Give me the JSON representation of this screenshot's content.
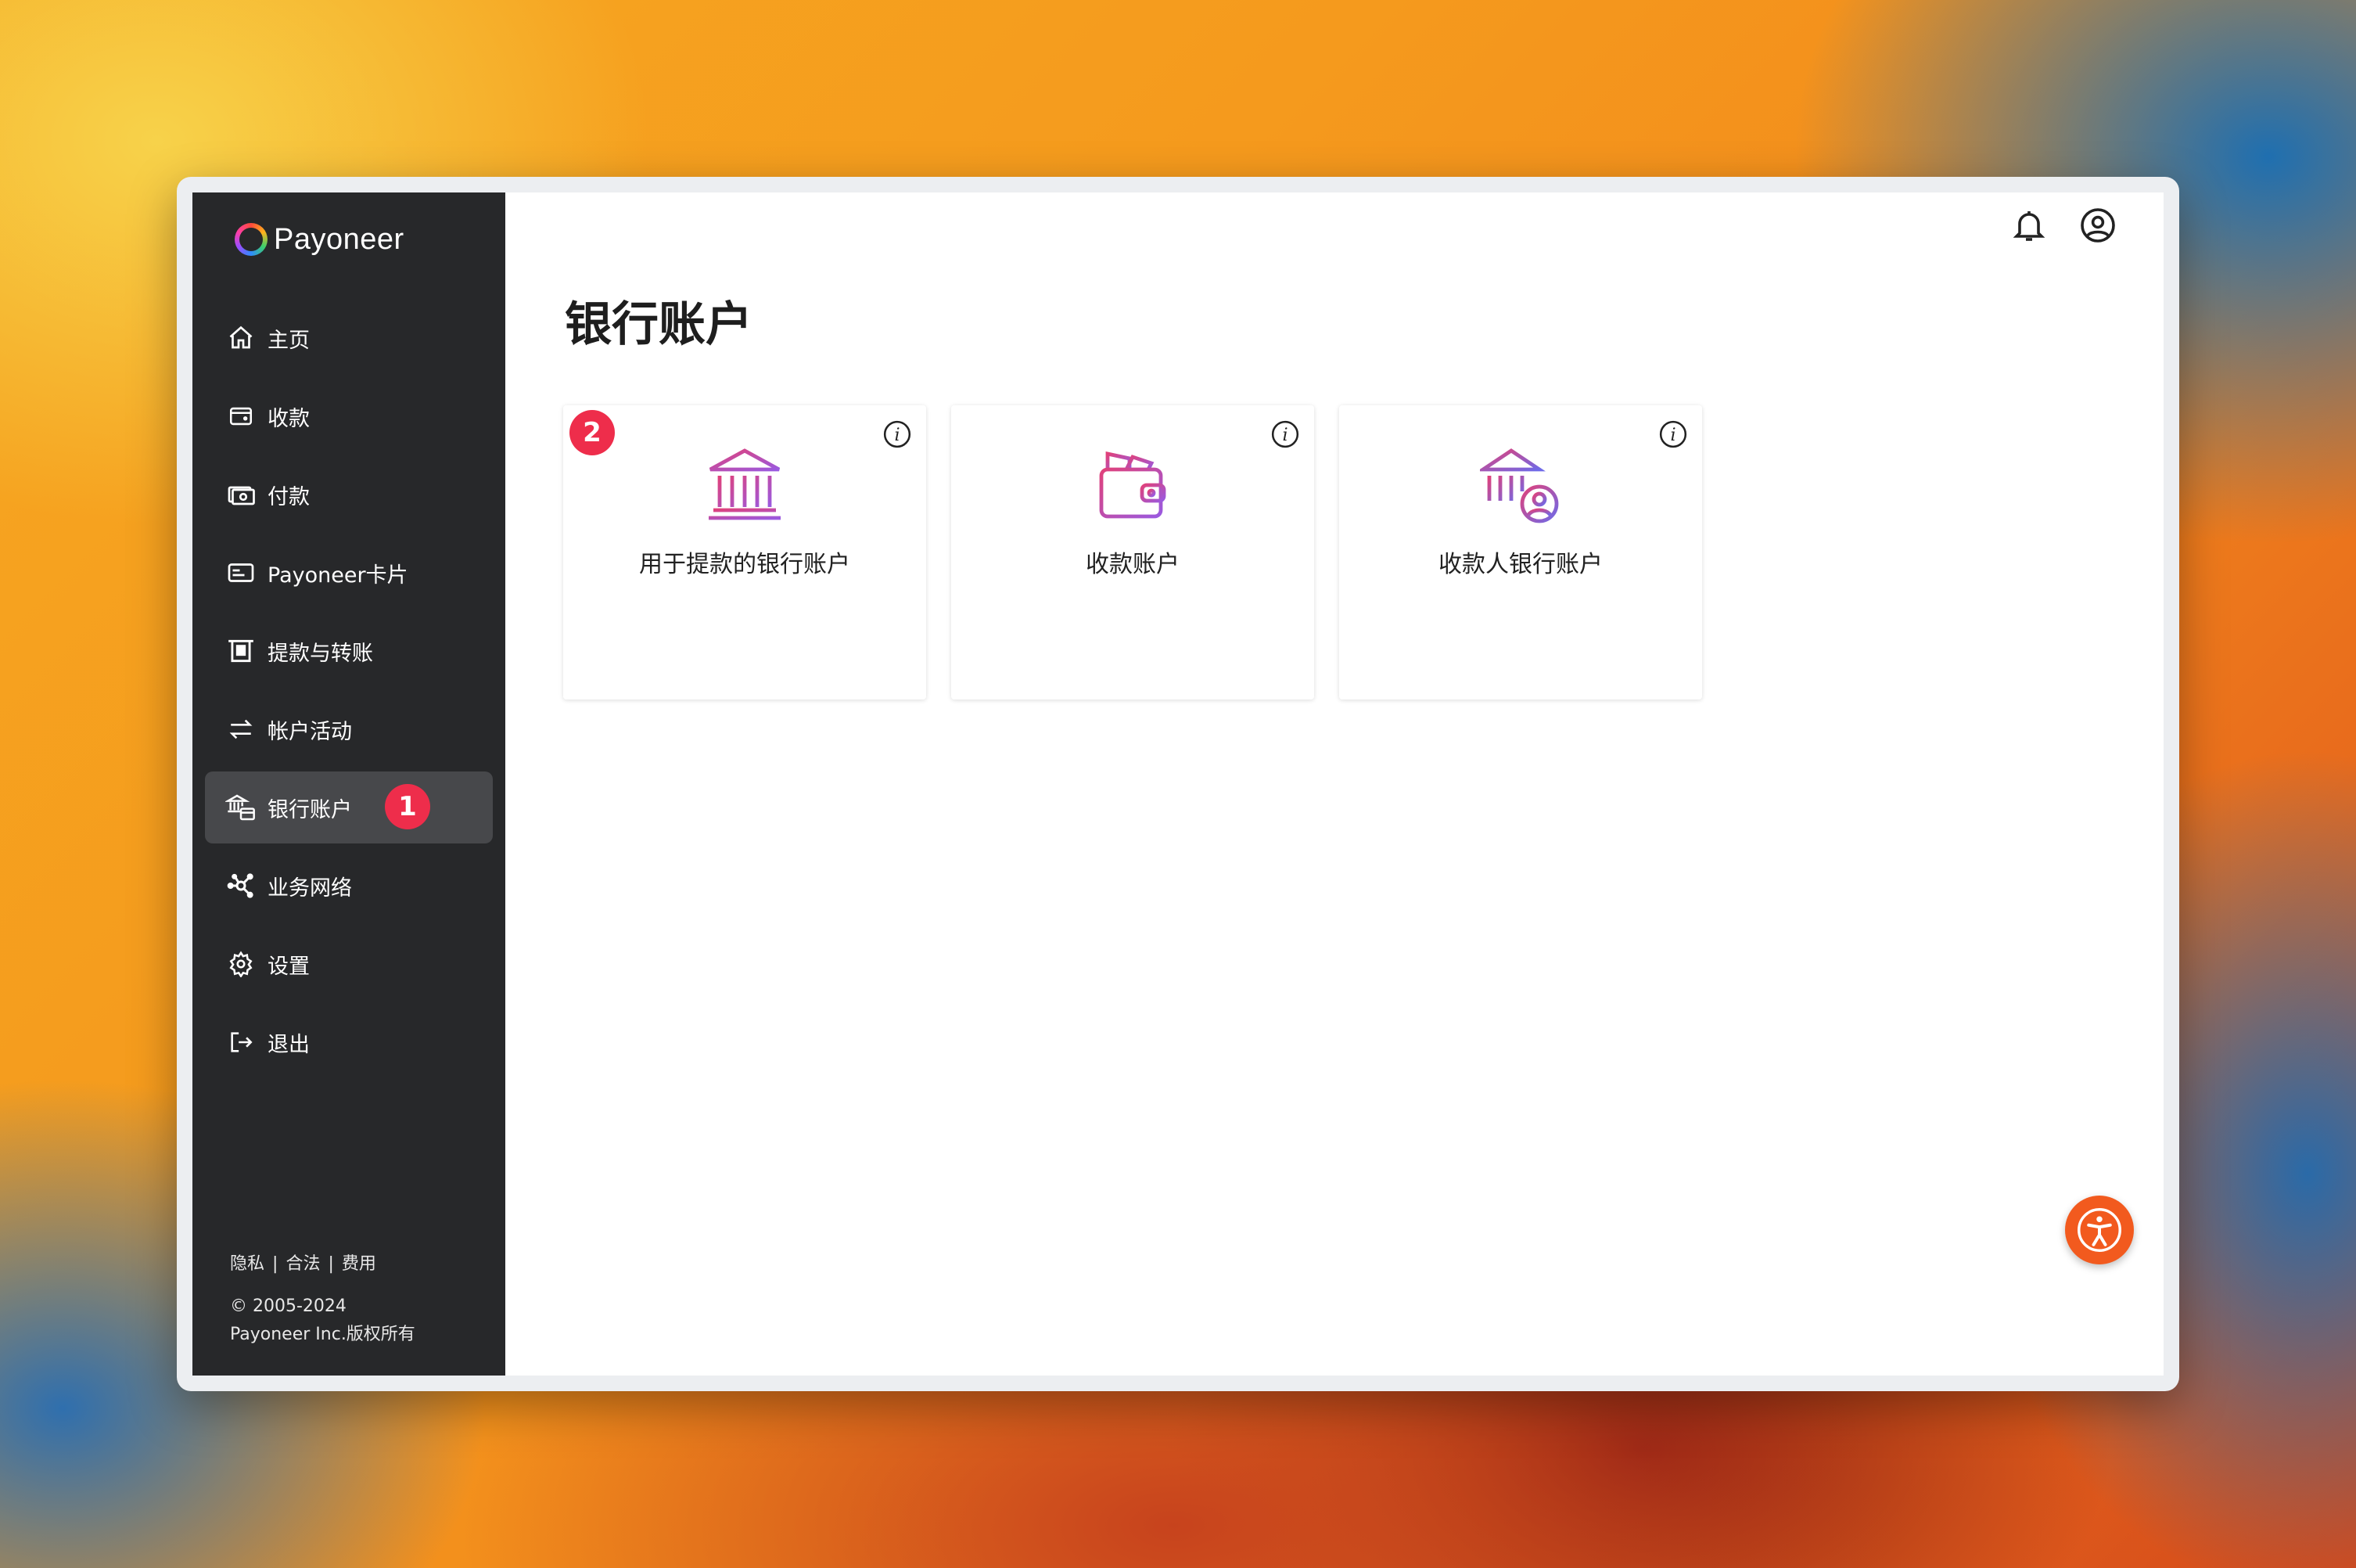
{
  "brand": {
    "name": "Payoneer"
  },
  "sidebar": {
    "items": [
      {
        "label": "主页",
        "icon": "home-icon"
      },
      {
        "label": "收款",
        "icon": "wallet-icon"
      },
      {
        "label": "付款",
        "icon": "cash-icon"
      },
      {
        "label": "Payoneer卡片",
        "icon": "card-icon"
      },
      {
        "label": "提款与转账",
        "icon": "withdraw-icon"
      },
      {
        "label": "帐户活动",
        "icon": "transfer-arrows-icon"
      },
      {
        "label": "银行账户",
        "icon": "bank-card-icon",
        "active": true
      },
      {
        "label": "业务网络",
        "icon": "network-icon"
      },
      {
        "label": "设置",
        "icon": "gear-icon"
      },
      {
        "label": "退出",
        "icon": "logout-icon"
      }
    ],
    "badge_step1": "1",
    "footer": {
      "links": [
        "隐私",
        "合法",
        "费用"
      ],
      "separator": "|",
      "copyright_line1": "© 2005-2024",
      "copyright_line2": "Payoneer Inc.版权所有"
    }
  },
  "main": {
    "title": "银行账户",
    "badge_step2": "2",
    "cards": [
      {
        "label": "用于提款的银行账户",
        "icon": "bank-icon"
      },
      {
        "label": "收款账户",
        "icon": "wallet-receive-icon"
      },
      {
        "label": "收款人银行账户",
        "icon": "bank-person-icon"
      }
    ]
  },
  "colors": {
    "sidebar_bg": "#27282a",
    "active_bg": "#47484b",
    "badge": "#ee2d4b",
    "accessibility": "#f25a1e"
  }
}
